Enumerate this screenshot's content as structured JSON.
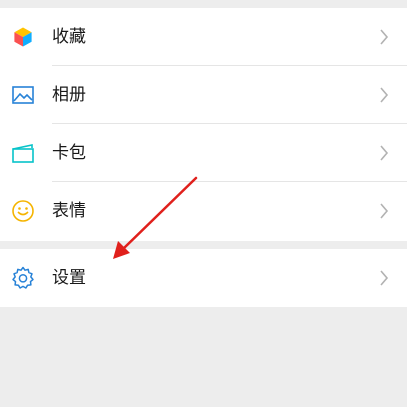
{
  "menu_items": [
    {
      "label": "收藏",
      "icon": "favorites-cube-icon"
    },
    {
      "label": "相册",
      "icon": "album-picture-icon"
    },
    {
      "label": "卡包",
      "icon": "card-wallet-icon"
    },
    {
      "label": "表情",
      "icon": "sticker-smile-icon"
    }
  ],
  "settings": {
    "label": "设置",
    "icon": "gear-icon"
  },
  "colors": {
    "background": "#ededed",
    "row_background": "#ffffff",
    "text": "#191919",
    "chevron": "#b2b2b2",
    "annotation_arrow": "#e0201c"
  }
}
